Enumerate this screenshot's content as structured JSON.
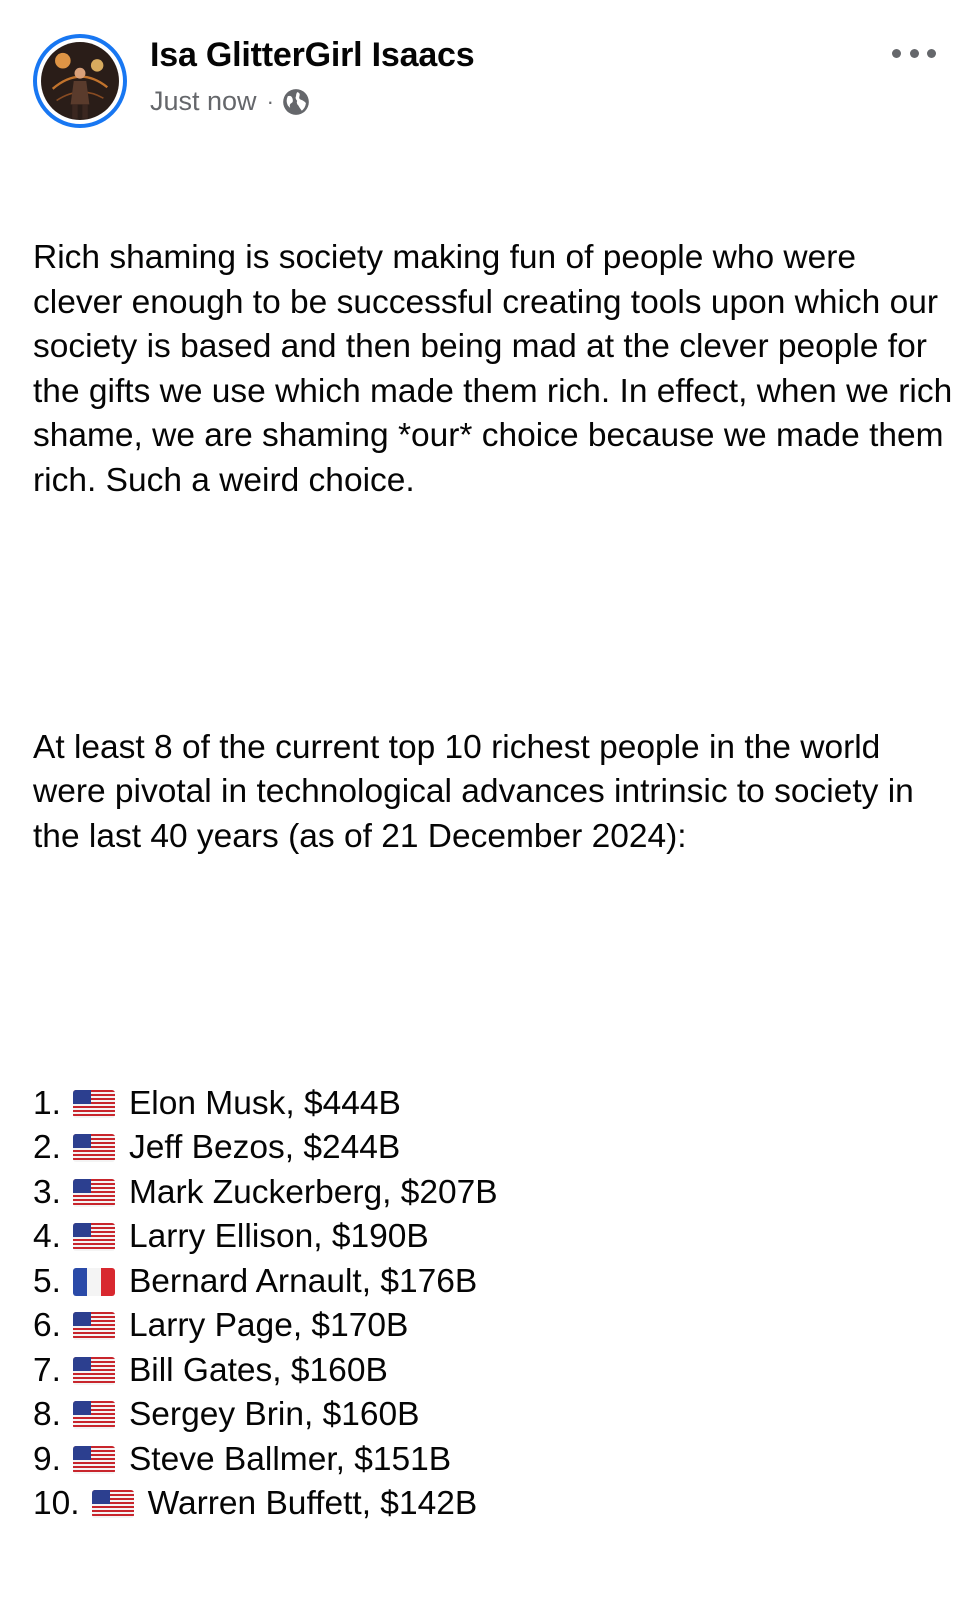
{
  "post": {
    "author": "Isa GlitterGirl Isaacs",
    "timestamp": "Just now",
    "separator": "·",
    "audience_icon": "globe-icon",
    "more_icon": "more-options-icon",
    "paragraphs": [
      "Rich shaming is society making fun of people who were clever enough to be successful creating tools upon which our society is based and then being mad at the clever people for the gifts we use which made them rich. In effect, when we rich shame, we are shaming *our* choice because we made them rich. Such a weird choice.",
      "At least 8 of the current top 10 richest people in the world were pivotal in technological advances intrinsic to society in the last 40 years (as of 21 December 2024):"
    ],
    "list": [
      {
        "num": "1.",
        "flag": "us",
        "text": "Elon Musk, $444B"
      },
      {
        "num": "2.",
        "flag": "us",
        "text": "Jeff Bezos, $244B"
      },
      {
        "num": "3.",
        "flag": "us",
        "text": "Mark Zuckerberg, $207B"
      },
      {
        "num": "4.",
        "flag": "us",
        "text": "Larry Ellison, $190B"
      },
      {
        "num": "5.",
        "flag": "fr",
        "text": "Bernard Arnault, $176B"
      },
      {
        "num": "6.",
        "flag": "us",
        "text": "Larry Page, $170B"
      },
      {
        "num": "7.",
        "flag": "us",
        "text": "Bill Gates, $160B"
      },
      {
        "num": "8.",
        "flag": "us",
        "text": "Sergey Brin, $160B"
      },
      {
        "num": "9.",
        "flag": "us",
        "text": "Steve Ballmer, $151B"
      },
      {
        "num": "10.",
        "flag": "us",
        "text": "Warren Buffett, $142B"
      }
    ]
  },
  "colors": {
    "accent": "#1877f2",
    "secondary_text": "#65676b",
    "primary_text": "#050505"
  }
}
